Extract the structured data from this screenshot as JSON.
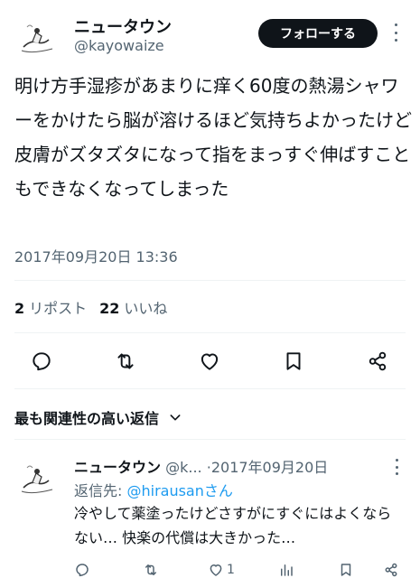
{
  "tweet": {
    "display_name": "ニュータウン",
    "handle": "@kayowaize",
    "follow_label": "フォローする",
    "text": "明け方手湿疹があまりに痒く60度の熱湯シャワーをかけたら脳が溶けるほど気持ちよかったけど皮膚がズタズタになって指をまっすぐ伸ばすこともできなくなってしまった",
    "timestamp": "2017年09月20日 13:36",
    "stats": {
      "retweets_count": "2",
      "retweets_label": "リポスト",
      "likes_count": "22",
      "likes_label": "いいね"
    }
  },
  "replies_sort": {
    "label": "最も関連性の高い返信"
  },
  "reply": {
    "display_name": "ニュータウン",
    "handle": "@k...",
    "separator": "·",
    "date": "2017年09月20日",
    "replying_prefix": "返信先: ",
    "replying_to": "@hirausanさん",
    "text": "冷やして薬塗ったけどさすがにすぐにはよくならない… 快楽の代償は大きかった…",
    "like_count": "1"
  },
  "icons": {
    "reply": "reply-icon",
    "retweet": "retweet-icon",
    "like": "like-icon",
    "bookmark": "bookmark-icon",
    "share": "share-icon",
    "views": "views-icon"
  },
  "colors": {
    "follow_bg": "#0f1419",
    "secondary_text": "#536471",
    "link": "#1d9bf0"
  }
}
